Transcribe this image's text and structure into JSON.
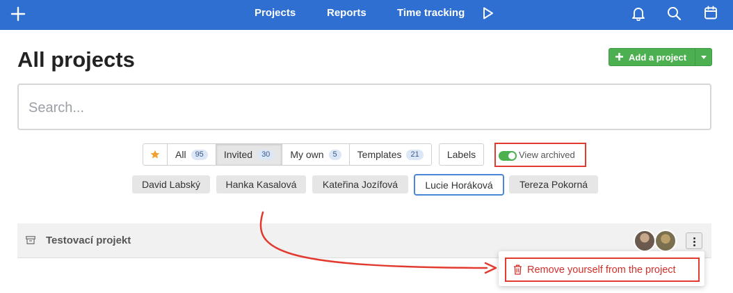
{
  "nav": {
    "links": [
      "Projects",
      "Reports",
      "Time tracking"
    ],
    "icons": [
      "plus-icon",
      "play-icon",
      "bell-icon",
      "search-icon",
      "calendar-icon"
    ],
    "bar_color": "#2f6fd1"
  },
  "page": {
    "title": "All projects",
    "add_button": "Add a project"
  },
  "search": {
    "placeholder": "Search..."
  },
  "filters": {
    "tabs": [
      {
        "label": "All",
        "count": "95",
        "active": false
      },
      {
        "label": "Invited",
        "count": "30",
        "active": true
      },
      {
        "label": "My own",
        "count": "5",
        "active": false
      },
      {
        "label": "Templates",
        "count": "21",
        "active": false
      }
    ],
    "labels_button": "Labels",
    "view_archived": "View archived",
    "view_archived_on": true
  },
  "people": [
    "David Labský",
    "Hanka Kasalová",
    "Kateřina Jozífová",
    "Lucie Horáková",
    "Tereza Pokorná"
  ],
  "people_selected": "Lucie Horáková",
  "project": {
    "name": "Testovací projekt"
  },
  "context_menu": {
    "remove": "Remove yourself from the project"
  },
  "colors": {
    "accent": "#2f6fd1",
    "success": "#4caf50",
    "highlight": "#e33a2f"
  }
}
